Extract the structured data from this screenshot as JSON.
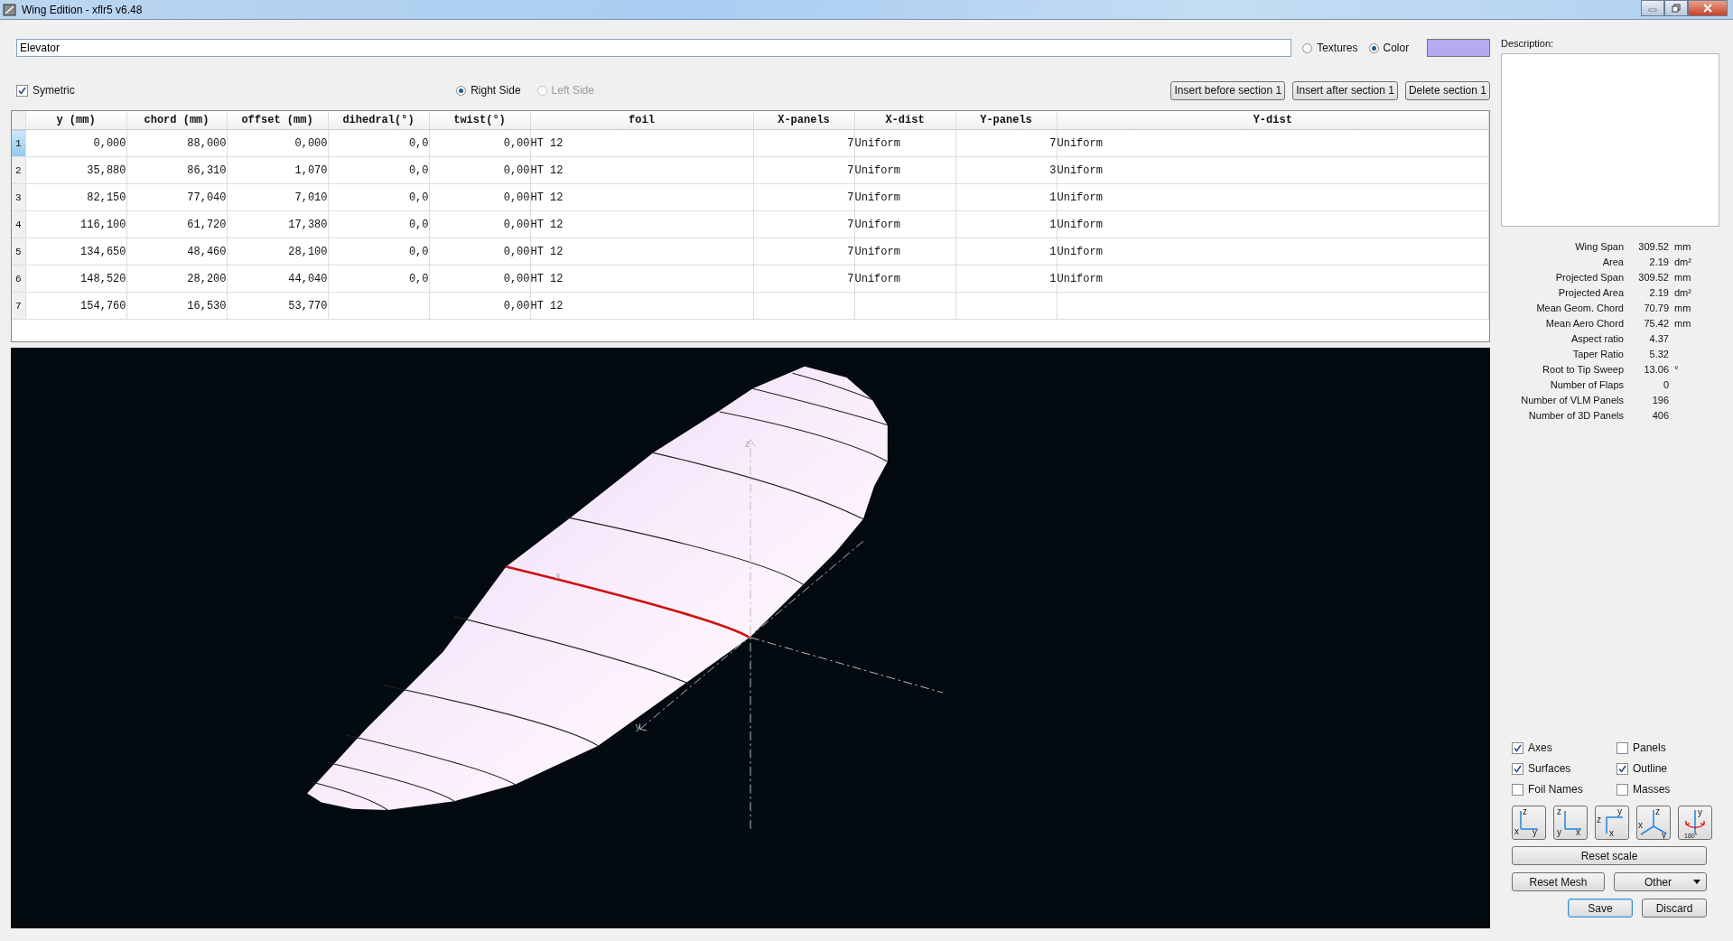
{
  "window": {
    "title": "Wing Edition - xflr5 v6.48"
  },
  "wing_name": {
    "value": "Elevator"
  },
  "appearance": [
    {
      "label": "Textures",
      "selected": false
    },
    {
      "label": "Color",
      "selected": true
    }
  ],
  "color_swatch": {
    "color": "#b4aaf0"
  },
  "symmetric": {
    "label": "Symetric",
    "checked": true
  },
  "sides": [
    {
      "label": "Right Side",
      "selected": true,
      "disabled": false
    },
    {
      "label": "Left Side",
      "selected": false,
      "disabled": true
    }
  ],
  "section_buttons": [
    "Insert before section 1",
    "Insert after section 1",
    "Delete section 1"
  ],
  "table": {
    "columns": [
      {
        "label": "y (mm)",
        "kind": "number"
      },
      {
        "label": "chord (mm)",
        "kind": "number"
      },
      {
        "label": "offset (mm)",
        "kind": "number"
      },
      {
        "label": "dihedral(°)",
        "kind": "number"
      },
      {
        "label": "twist(°)",
        "kind": "number"
      },
      {
        "label": "foil",
        "kind": "text"
      },
      {
        "label": "X-panels",
        "kind": "number"
      },
      {
        "label": "X-dist",
        "kind": "text"
      },
      {
        "label": "Y-panels",
        "kind": "number"
      },
      {
        "label": "Y-dist",
        "kind": "text"
      }
    ],
    "rows": [
      {
        "index": "1",
        "selected": true,
        "cells": [
          "0,000",
          "88,000",
          "0,000",
          "0,0",
          "0,00",
          "HT 12",
          "7",
          "Uniform",
          "7",
          "Uniform"
        ]
      },
      {
        "index": "2",
        "selected": false,
        "cells": [
          "35,880",
          "86,310",
          "1,070",
          "0,0",
          "0,00",
          "HT 12",
          "7",
          "Uniform",
          "3",
          "Uniform"
        ]
      },
      {
        "index": "3",
        "selected": false,
        "cells": [
          "82,150",
          "77,040",
          "7,010",
          "0,0",
          "0,00",
          "HT 12",
          "7",
          "Uniform",
          "1",
          "Uniform"
        ]
      },
      {
        "index": "4",
        "selected": false,
        "cells": [
          "116,100",
          "61,720",
          "17,380",
          "0,0",
          "0,00",
          "HT 12",
          "7",
          "Uniform",
          "1",
          "Uniform"
        ]
      },
      {
        "index": "5",
        "selected": false,
        "cells": [
          "134,650",
          "48,460",
          "28,100",
          "0,0",
          "0,00",
          "HT 12",
          "7",
          "Uniform",
          "1",
          "Uniform"
        ]
      },
      {
        "index": "6",
        "selected": false,
        "cells": [
          "148,520",
          "28,200",
          "44,040",
          "0,0",
          "0,00",
          "HT 12",
          "7",
          "Uniform",
          "1",
          "Uniform"
        ]
      },
      {
        "index": "7",
        "selected": false,
        "cells": [
          "154,760",
          "16,530",
          "53,770",
          null,
          "0,00",
          "HT 12",
          null,
          null,
          null,
          null
        ]
      }
    ]
  },
  "view": {
    "axis_labels": [
      "z",
      "x",
      "y"
    ]
  },
  "description": {
    "label": "Description:"
  },
  "stats": [
    {
      "label": "Wing Span",
      "value": "309.52",
      "unit": "mm"
    },
    {
      "label": "Area",
      "value": "2.19",
      "unit": "dm²"
    },
    {
      "label": "Projected Span",
      "value": "309.52",
      "unit": "mm"
    },
    {
      "label": "Projected Area",
      "value": "2.19",
      "unit": "dm²"
    },
    {
      "label": "Mean Geom. Chord",
      "value": "70.79",
      "unit": "mm"
    },
    {
      "label": "Mean Aero Chord",
      "value": "75.42",
      "unit": "mm"
    },
    {
      "label": "Aspect ratio",
      "value": "4.37"
    },
    {
      "label": "Taper Ratio",
      "value": "5.32"
    },
    {
      "label": "Root to Tip Sweep",
      "value": "13.06",
      "unit": "°"
    },
    {
      "label": "Number of Flaps",
      "value": "0"
    },
    {
      "label": "Number of VLM Panels",
      "value": "196"
    },
    {
      "label": "Number of 3D Panels",
      "value": "406"
    }
  ],
  "display_options": [
    {
      "label": "Axes",
      "checked": true
    },
    {
      "label": "Panels",
      "checked": false
    },
    {
      "label": "Surfaces",
      "checked": true
    },
    {
      "label": "Outline",
      "checked": true
    },
    {
      "label": "Foil Names",
      "checked": false
    },
    {
      "label": "Masses",
      "checked": false
    }
  ],
  "view_buttons": [
    {
      "kind": "front",
      "labels": [
        "z",
        "x",
        "y"
      ]
    },
    {
      "kind": "side",
      "labels": [
        "z",
        "y",
        "x"
      ]
    },
    {
      "kind": "top",
      "labels": [
        "y",
        "z",
        "x"
      ]
    },
    {
      "kind": "iso",
      "labels": [
        "z",
        "x",
        "y"
      ]
    },
    {
      "kind": "flip",
      "labels": [
        "y",
        "180°"
      ]
    }
  ],
  "buttons": {
    "reset_scale": "Reset scale",
    "reset_mesh": "Reset Mesh",
    "other_menu": "Other",
    "save": "Save",
    "discard": "Discard"
  }
}
